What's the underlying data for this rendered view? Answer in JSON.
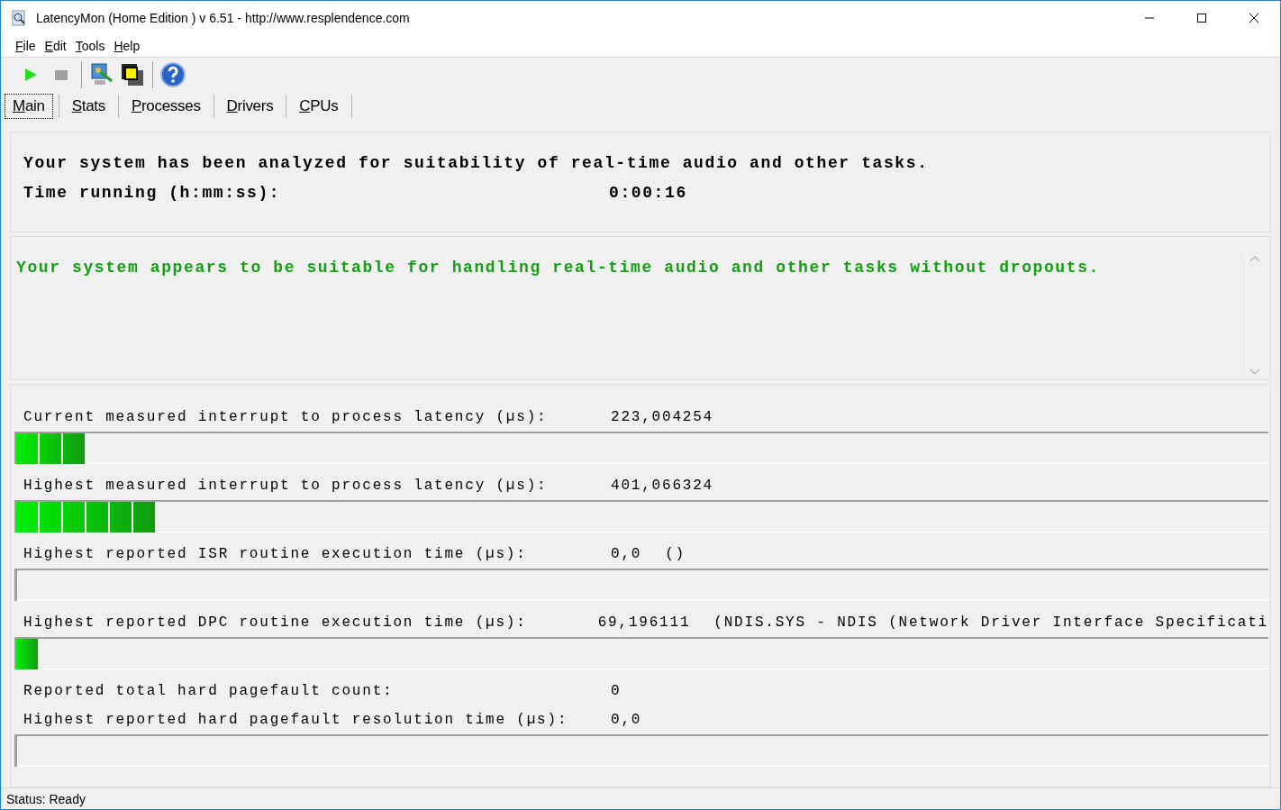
{
  "window": {
    "title": "LatencyMon  (Home Edition )  v 6.51 - http://www.resplendence.com"
  },
  "menu": [
    "File",
    "Edit",
    "Tools",
    "Help"
  ],
  "tabs": [
    {
      "label": "Main",
      "selected": true
    },
    {
      "label": "Stats",
      "selected": false
    },
    {
      "label": "Processes",
      "selected": false
    },
    {
      "label": "Drivers",
      "selected": false
    },
    {
      "label": "CPUs",
      "selected": false
    }
  ],
  "summary": {
    "headline": "Your system has been analyzed for suitability of real-time audio and other tasks.",
    "time_label": "Time running (h:mm:ss):",
    "time_value": "0:00:16"
  },
  "verdict": "Your system appears to be suitable for handling real-time audio and other tasks without dropouts.",
  "metrics": [
    {
      "kind": "meter",
      "label": "Current measured interrupt to process latency (µs):",
      "value": "223,004254",
      "level": 0.056
    },
    {
      "kind": "meter",
      "label": "Highest measured interrupt to process latency (µs):",
      "value": "401,066324",
      "level": 0.112
    },
    {
      "kind": "meter",
      "label": "Highest reported ISR routine execution time (µs):",
      "value": "0,0",
      "detail": "()",
      "level": 0
    },
    {
      "kind": "meter",
      "label": "Highest reported DPC routine execution time (µs):",
      "value": "69,196111",
      "detail": "(NDIS.SYS - NDIS (Network Driver Interface Specificati",
      "level": 0.018
    },
    {
      "kind": "text",
      "label": "Reported total hard pagefault count:",
      "value": "0"
    },
    {
      "kind": "meter",
      "label": "Highest reported hard pagefault resolution time (µs):",
      "value": "0,0",
      "level": 0
    }
  ],
  "status_bar": "Status: Ready"
}
